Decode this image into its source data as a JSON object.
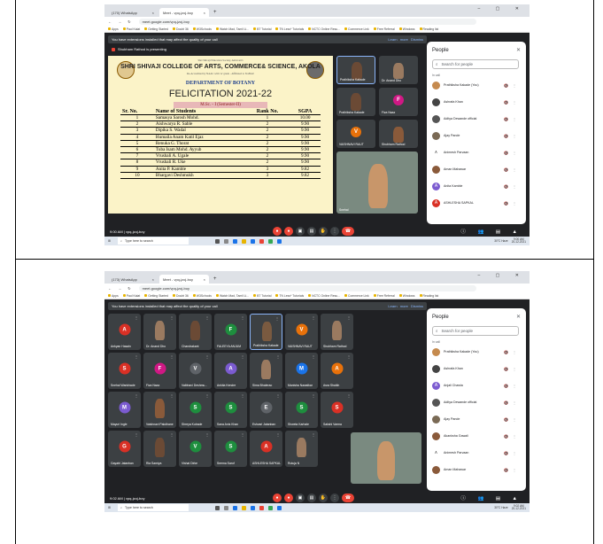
{
  "shots": [
    {
      "tabs": [
        {
          "label": "(170) WhatsApp"
        },
        {
          "label": "Meet - vpq-jzoj-boy"
        }
      ],
      "url": "meet.google.com/vpq-jzoj-boy",
      "bookmarks": [
        "Apps",
        "Paul Kalat",
        "Getting Started",
        "Doubt 36",
        "W3Schools",
        "Watch Mad, Tamil Li...",
        "BT Tutorial",
        "TN Less* Tutorials",
        "NCTC Online Resu...",
        "Commerce Link",
        "Free Referral",
        "Windows",
        "Reading list"
      ],
      "warning": "You have extensions installed that may affect the quality of your call",
      "warn_links": "Learn more   Dismiss",
      "presenting": "Shubham Rathod is presenting",
      "time_code": "9:00 AM  |  vpq-jzoj-boy",
      "search_placeholder": "Type here to search",
      "clock": "9:00 AM\n20-12-2021",
      "weather": "30°C Haze",
      "panel": {
        "title": "People",
        "search": "Search for people",
        "in_call": "In call",
        "people": [
          {
            "name": "Prathiksha Kakade (You)",
            "color": "#c58a4e",
            "letter": ""
          },
          {
            "name": "Ashrafa Khan",
            "color": "#444",
            "letter": ""
          },
          {
            "name": "Aditya Dewande official",
            "color": "#555",
            "letter": ""
          },
          {
            "name": "Ajay Pande",
            "color": "#7a6a55",
            "letter": ""
          },
          {
            "name": "Animesh Parvaan",
            "color": "#fff",
            "letter": ""
          },
          {
            "name": "Aman Mahawar",
            "color": "#8a5a3a",
            "letter": ""
          },
          {
            "name": "Anita Kamble",
            "color": "#7b5bd0",
            "letter": "A"
          },
          {
            "name": "ASHLESHA SAPKAL",
            "color": "#d93025",
            "letter": "A"
          }
        ]
      },
      "slide": {
        "top": "Shri Shivaji Education Society, Amravati's",
        "college": "SHRI SHIVAJI COLLEGE OF ARTS, COMMERCE& SCIENCE, AKOLA",
        "sub": "Re-Accredited by NAAC with 'A' grade - Affiliated to SGBAU",
        "dept": "DEPARTMENT OF BOTANY",
        "fel": "FELICITATION 2021-22",
        "sem": "M.Sc. - I (Semester-II)",
        "headers": [
          "Sr. No.",
          "Name of Students",
          "Rank No.",
          "SGPA"
        ],
        "rows": [
          [
            "1",
            "Samasya Sarosh Mohd.",
            "1",
            "10.00"
          ],
          [
            "2",
            "Aishwarya R. Sable",
            "2",
            "9.90"
          ],
          [
            "3",
            "Dipika S. Wadal",
            "2",
            "9.90"
          ],
          [
            "4",
            "Humaila Anam Katil Ejaz",
            "2",
            "9.90"
          ],
          [
            "5",
            "Renuka G. Thorat",
            "2",
            "9.90"
          ],
          [
            "6",
            "Tuba Isam Mohd. Ayyub",
            "2",
            "9.90"
          ],
          [
            "7",
            "Vrushali A. Ugale",
            "2",
            "9.90"
          ],
          [
            "8",
            "Vrushali R. Uke",
            "2",
            "9.90"
          ],
          [
            "9",
            "Anita P. Kamble",
            "3",
            "9.82"
          ],
          [
            "10",
            "Bhargavi  Deshmukh",
            "3",
            "9.82"
          ]
        ]
      },
      "tiles": [
        {
          "name": "Prathiksha Kakade"
        },
        {
          "name": "Dr. Anand Dho"
        },
        {
          "name": "Prathiksha Kakade"
        },
        {
          "name": "Fiza Naaz"
        },
        {
          "name": "VAISHNAVI RAUT"
        },
        {
          "name": "Shubham Rathod"
        },
        {
          "name": "Snehal"
        }
      ]
    },
    {
      "tabs": [
        {
          "label": "(173) WhatsApp"
        },
        {
          "label": "Meet - vpq-jzoj-boy"
        }
      ],
      "url": "meet.google.com/vpq-jzoj-boy",
      "bookmarks": [
        "Apps",
        "Paul Kalat",
        "Getting Started",
        "Doubt 36",
        "W3Schools",
        "Watch Mad, Tamil Li...",
        "BT Tutorial",
        "TN Less* Tutorials",
        "NCTC Online Resu...",
        "Commerce Link",
        "Free Referral",
        "Windows",
        "Reading list"
      ],
      "warning": "You have extensions installed that may affect the quality of your call",
      "warn_links": "Learn more   Dismiss",
      "time_code": "9:02 AM  |  vpq-jzoj-boy",
      "search_placeholder": "Type here to search",
      "clock": "9:02 AM\n20-12-2021",
      "weather": "30°C Haze",
      "panel": {
        "title": "People",
        "search": "Search for people",
        "in_call": "In call",
        "people": [
          {
            "name": "Prathiksha Kakade (You)",
            "color": "#c58a4e",
            "letter": ""
          },
          {
            "name": "Ashrafa Khan",
            "color": "#444",
            "letter": ""
          },
          {
            "name": "Anjali Chawla",
            "color": "#7b5bd0",
            "letter": "A"
          },
          {
            "name": "Aditya Dewande official",
            "color": "#555",
            "letter": ""
          },
          {
            "name": "Ajay Pande",
            "color": "#7a6a55",
            "letter": ""
          },
          {
            "name": "Akanksha Gawali",
            "color": "#8a5a3a",
            "letter": ""
          },
          {
            "name": "Animesh Parvaan",
            "color": "#fff",
            "letter": ""
          },
          {
            "name": "Aman Mahawar",
            "color": "#8a5a3a",
            "letter": ""
          }
        ]
      },
      "grid": [
        {
          "name": "Ankyan Hasain",
          "letter": "A",
          "color": "#d93025"
        },
        {
          "name": "Dr. Anand Dho",
          "letter": "",
          "color": ""
        },
        {
          "name": "Chandrakant",
          "letter": "",
          "color": ""
        },
        {
          "name": "FALEEYA ANJUM",
          "letter": "F",
          "color": "#1e8e3e"
        },
        {
          "name": "Prathiksha Kakade",
          "letter": "",
          "color": ""
        },
        {
          "name": "VAISHNAVI RAUT",
          "letter": "V",
          "color": "#e8710a"
        },
        {
          "name": "Shubham Rathod",
          "letter": "",
          "color": ""
        },
        {
          "name": "Snehal Wankhade",
          "letter": "S",
          "color": "#d93025"
        },
        {
          "name": "Fiza Naaz",
          "letter": "F",
          "color": "#d01884"
        },
        {
          "name": "Vaibhavi Deshmu...",
          "letter": "V",
          "color": "#5f6368"
        },
        {
          "name": "Ankita Kendre",
          "letter": "A",
          "color": "#7b5bd0"
        },
        {
          "name": "Sima Bhalerao",
          "letter": "",
          "color": ""
        },
        {
          "name": "Manisha Nawalkar",
          "letter": "M",
          "color": "#1a73e8"
        },
        {
          "name": "Asra Shaikh",
          "letter": "A",
          "color": "#e8710a"
        },
        {
          "name": "Mayuri Ingle",
          "letter": "M",
          "color": "#7b5bd0"
        },
        {
          "name": "Vaishnavi Pakdhane",
          "letter": "",
          "color": ""
        },
        {
          "name": "Shreya Kubade",
          "letter": "S",
          "color": "#1e8e3e"
        },
        {
          "name": "Sana Anis Khan",
          "letter": "S",
          "color": "#1e8e3e"
        },
        {
          "name": "Eshvari Jatanban",
          "letter": "E",
          "color": "#5f6368"
        },
        {
          "name": "Shweta Karhale",
          "letter": "S",
          "color": "#1e8e3e"
        },
        {
          "name": "Sakshi Varma",
          "letter": "S",
          "color": "#d93025"
        },
        {
          "name": "Gayatri Jatanban",
          "letter": "G",
          "color": "#d93025"
        },
        {
          "name": "Ria Samiya",
          "letter": "",
          "color": ""
        },
        {
          "name": "Vishal Dirke",
          "letter": "V",
          "color": "#1e8e3e"
        },
        {
          "name": "Seema Sarof",
          "letter": "S",
          "color": "#1e8e3e"
        },
        {
          "name": "ASHLESHA SAPKAL",
          "letter": "A",
          "color": "#d93025"
        },
        {
          "name": "Rutuja N",
          "letter": "",
          "color": ""
        }
      ]
    }
  ]
}
